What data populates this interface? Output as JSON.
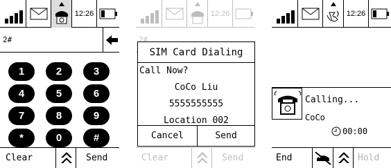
{
  "status": {
    "time": "12:26"
  },
  "dialer": {
    "input_value": "2#",
    "keys": [
      "1",
      "2",
      "3",
      "4",
      "5",
      "6",
      "7",
      "8",
      "9",
      "*",
      "0",
      "#"
    ],
    "bottom": {
      "left": "Clear",
      "right": "Send"
    }
  },
  "sim_dialog": {
    "bg_input": "2#",
    "title": "SIM Card Dialing",
    "prompt": "Call Now?",
    "name": "CoCo Liu",
    "number": "5555555555",
    "location": "Location 002",
    "cancel": "Cancel",
    "send": "Send",
    "bottom": {
      "left": "Clear",
      "right": "Send"
    }
  },
  "calling": {
    "status": "Calling...",
    "name": "CoCo",
    "timer": "00:00",
    "bottom": {
      "left": "End",
      "right": "Hold"
    }
  }
}
